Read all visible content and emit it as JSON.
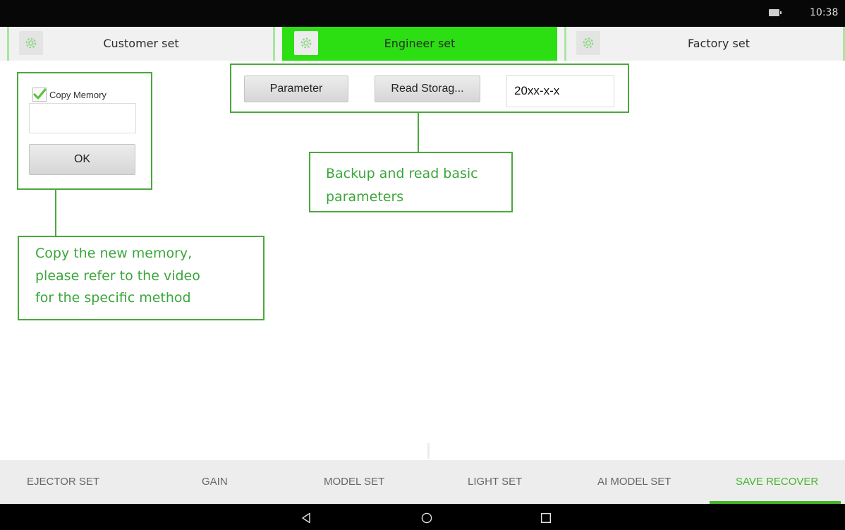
{
  "status_bar": {
    "time": "10:38",
    "battery_icon": "battery-icon"
  },
  "colors": {
    "accent": "#2bdf12",
    "callout": "#4aa83c",
    "nav_active": "#44b62b"
  },
  "top_tabs": [
    {
      "label": "Customer set",
      "icon": "gear-icon",
      "active": false
    },
    {
      "label": "Engineer set",
      "icon": "gear-icon",
      "active": true
    },
    {
      "label": "Factory set",
      "icon": "gear-icon",
      "active": false
    }
  ],
  "copy_panel": {
    "checkbox_label": "Copy Memory",
    "checked": true,
    "input_value": "",
    "ok_label": "OK"
  },
  "backup_panel": {
    "parameter_label": "Parameter",
    "read_storage_label": "Read Storag...",
    "date_value": "20xx-x-x"
  },
  "callouts": {
    "backup": [
      "Backup and read basic",
      "parameters"
    ],
    "copy": [
      "Copy the new memory,",
      "please refer to the video",
      "for the specific method"
    ]
  },
  "bottom_nav": [
    {
      "label": "EJECTOR SET",
      "active": false
    },
    {
      "label": "GAIN",
      "active": false
    },
    {
      "label": "MODEL SET",
      "active": false
    },
    {
      "label": "LIGHT SET",
      "active": false
    },
    {
      "label": "AI MODEL SET",
      "active": false
    },
    {
      "label": "SAVE RECOVER",
      "active": true
    }
  ],
  "system_nav": {
    "back": "back-icon",
    "home": "home-icon",
    "recents": "recents-icon"
  }
}
